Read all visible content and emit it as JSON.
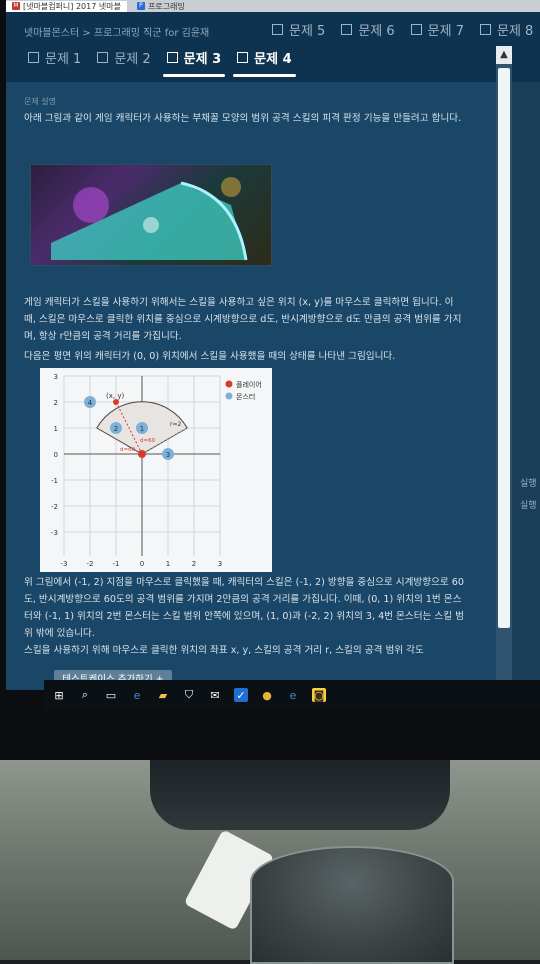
{
  "browser": {
    "tabs": [
      {
        "label": "[넷마블컴퍼니] 2017 넷마블",
        "favicon_color": "#c0392b",
        "favicon_glyph": "M"
      },
      {
        "label": "프로그래밍",
        "favicon_color": "#2a6ad8",
        "favicon_glyph": "P"
      }
    ]
  },
  "breadcrumb": "넷마블몬스터 > 프로그래밍 직군 for 김윤재",
  "problem_tabs": [
    {
      "label": "문제 1"
    },
    {
      "label": "문제 2"
    },
    {
      "label": "문제 3"
    },
    {
      "label": "문제 4"
    },
    {
      "label": "문제 5"
    },
    {
      "label": "문제 6"
    },
    {
      "label": "문제 7"
    },
    {
      "label": "문제 8"
    }
  ],
  "content": {
    "section_title": "문제 설명",
    "intro": "아래 그림과 같이 게임 캐릭터가 사용하는 부채꼴 모양의 범위 공격 스킬의 피격 판정 기능을 만들려고 합니다.",
    "para2": "게임 캐릭터가 스킬을 사용하기 위해서는 스킬을 사용하고 싶은 위치 (x, y)를 마우스로 클릭하면 됩니다. 이때, 스킬은 마우스로 클릭한 위치를 중심으로 시계방향으로 d도, 반시계방향으로 d도 만큼의 공격 범위를 가지며, 항상 r만큼의 공격 거리를 가집니다.",
    "para3": "다음은 평면 위의 캐릭터가 (0, 0) 위치에서 스킬을 사용했을 때의 상태를 나타낸 그림입니다.",
    "para4": "위 그림에서 (-1, 2) 지점을 마우스로 클릭했을 때, 캐릭터의 스킬은 (-1, 2) 방향을 중심으로 시계방향으로 60도, 반시계방향으로 60도의 공격 범위를 가지며 2만큼의 공격 거리를 가집니다. 이때, (0, 1) 위치의 1번 몬스터와 (-1, 1) 위치의 2번 몬스터는 스킬 범위 안쪽에 있으며, (1, 0)과 (-2, 2) 위치의 3, 4번 몬스터는 스킬 범위 밖에 있습니다.",
    "para5": "스킬을 사용하기 위해 마우스로 클릭한 위치의 좌표 x, y, 스킬의 공격 거리 r, 스킬의 공격 범위 각도"
  },
  "figure": {
    "legend": [
      {
        "label": "플레이어",
        "color": "#d93a2b"
      },
      {
        "label": "몬스터",
        "color": "#7fb1d6"
      }
    ],
    "x_ticks": [
      "-3",
      "-2",
      "-1",
      "0",
      "1",
      "2",
      "3"
    ],
    "y_ticks": [
      "3",
      "2",
      "1",
      "0",
      "-1",
      "-2",
      "-3"
    ],
    "annotations": {
      "click": "(x, y)",
      "range": "r=2",
      "angle1": "d=60",
      "angle2": "d=60"
    },
    "monsters": [
      {
        "id": "1",
        "x": 0,
        "y": 1
      },
      {
        "id": "2",
        "x": -1,
        "y": 1
      },
      {
        "id": "3",
        "x": 1,
        "y": 0
      },
      {
        "id": "4",
        "x": -2,
        "y": 2
      }
    ],
    "player": {
      "x": 0,
      "y": 0
    },
    "click_point": {
      "x": -1,
      "y": 2
    }
  },
  "add_testcase_button": "테스트케이스 추가하기 +",
  "side_panel": {
    "run_label_1": "실행",
    "run_label_2": "실행"
  },
  "taskbar_icons": [
    "windows-icon",
    "search-icon",
    "task-view-icon",
    "edge-icon",
    "explorer-icon",
    "store-icon",
    "mail-icon",
    "app-icon",
    "chrome-icon",
    "ie-icon",
    "kakaotalk-icon"
  ]
}
